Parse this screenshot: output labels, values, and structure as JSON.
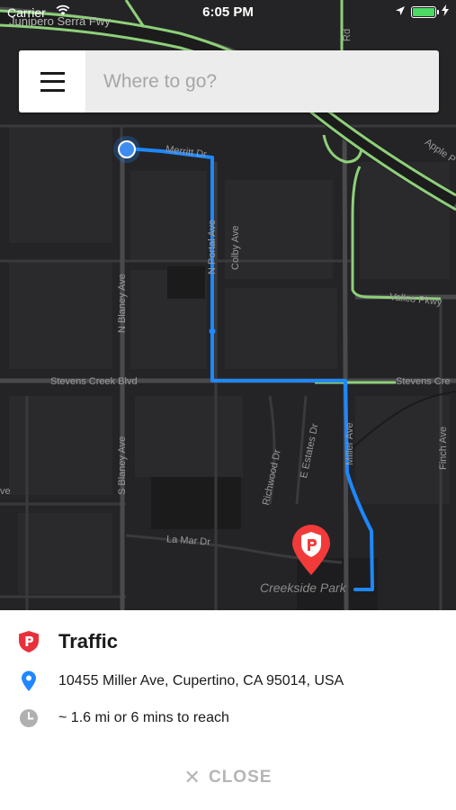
{
  "status_bar": {
    "carrier": "Carrier",
    "time": "6:05 PM",
    "battery_color": "#4cd964"
  },
  "search": {
    "placeholder": "Where to go?",
    "menu_icon": "hamburger-menu-icon"
  },
  "map": {
    "streets": [
      {
        "label": "Junipero Serra Fwy"
      },
      {
        "label": "Rd"
      },
      {
        "label": "Apple P"
      },
      {
        "label": "Merritt Dr"
      },
      {
        "label": "N Portal Ave"
      },
      {
        "label": "Colby Ave"
      },
      {
        "label": "N Blaney Ave"
      },
      {
        "label": "Vallco Pkwy"
      },
      {
        "label": "Stevens Creek Blvd"
      },
      {
        "label": "Stevens Cre"
      },
      {
        "label": "S Blaney Ave"
      },
      {
        "label": "Richwood Dr"
      },
      {
        "label": "E Estates Dr"
      },
      {
        "label": "Miller Ave"
      },
      {
        "label": "Finch Ave"
      },
      {
        "label": "ve"
      },
      {
        "label": "La Mar Dr"
      },
      {
        "label": "Creekside Park"
      }
    ],
    "route_color": "#1e88ff",
    "highway_color": "#8ed07a",
    "destination_pin_icon": "parking-pin-icon",
    "pin_color": "#f23a3a"
  },
  "details": {
    "title": "Traffic",
    "address": "10455 Miller Ave, Cupertino, CA 95014, USA",
    "eta": "~ 1.6 mi or 6 mins to reach",
    "close_label": "CLOSE",
    "title_icon": "parking-shield-icon",
    "address_icon": "location-pin-icon",
    "eta_icon": "clock-icon",
    "accent_red": "#e8313a",
    "accent_blue": "#1e88ff"
  }
}
